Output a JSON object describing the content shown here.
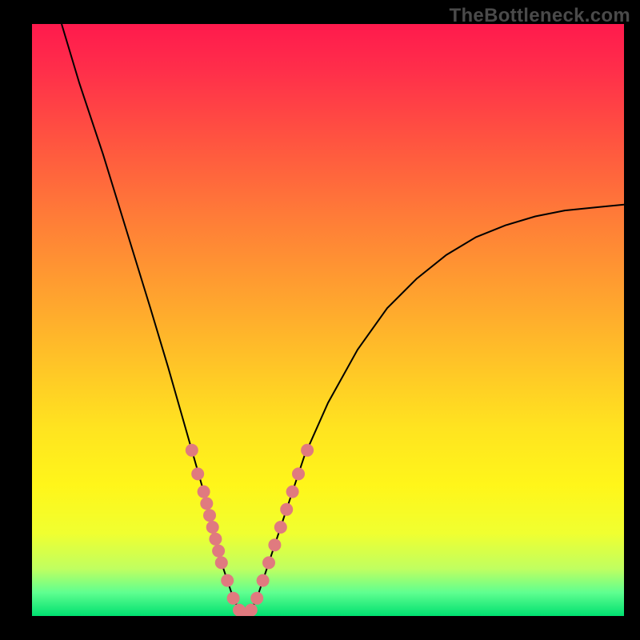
{
  "watermark": "TheBottleneck.com",
  "colors": {
    "frame": "#000000",
    "marker": "#e07a7f",
    "curve": "#000000",
    "gradient_top": "#ff1a4d",
    "gradient_bottom": "#00e070"
  },
  "chart_data": {
    "type": "line",
    "title": "",
    "xlabel": "",
    "ylabel": "",
    "xlim": [
      0,
      100
    ],
    "ylim": [
      0,
      100
    ],
    "grid": false,
    "legend": false,
    "series": [
      {
        "name": "bottleneck-curve",
        "x": [
          5,
          8,
          12,
          16,
          20,
          23,
          25,
          27,
          29,
          30,
          31,
          32,
          33,
          34,
          35,
          36,
          37,
          38,
          39,
          40,
          42,
          44,
          46,
          50,
          55,
          60,
          65,
          70,
          75,
          80,
          85,
          90,
          95,
          100
        ],
        "y": [
          100,
          90,
          78,
          65,
          52,
          42,
          35,
          28,
          21,
          17,
          13,
          9,
          6,
          3,
          1,
          0,
          1,
          3,
          6,
          9,
          15,
          21,
          27,
          36,
          45,
          52,
          57,
          61,
          64,
          66,
          67.5,
          68.5,
          69,
          69.5
        ]
      }
    ],
    "markers": {
      "name": "highlight-points",
      "points": [
        {
          "x": 27,
          "y": 28
        },
        {
          "x": 28,
          "y": 24
        },
        {
          "x": 29,
          "y": 21
        },
        {
          "x": 29.5,
          "y": 19
        },
        {
          "x": 30,
          "y": 17
        },
        {
          "x": 30.5,
          "y": 15
        },
        {
          "x": 31,
          "y": 13
        },
        {
          "x": 31.5,
          "y": 11
        },
        {
          "x": 32,
          "y": 9
        },
        {
          "x": 33,
          "y": 6
        },
        {
          "x": 34,
          "y": 3
        },
        {
          "x": 35,
          "y": 1
        },
        {
          "x": 36,
          "y": 0
        },
        {
          "x": 37,
          "y": 1
        },
        {
          "x": 38,
          "y": 3
        },
        {
          "x": 39,
          "y": 6
        },
        {
          "x": 40,
          "y": 9
        },
        {
          "x": 41,
          "y": 12
        },
        {
          "x": 42,
          "y": 15
        },
        {
          "x": 43,
          "y": 18
        },
        {
          "x": 44,
          "y": 21
        },
        {
          "x": 45,
          "y": 24
        },
        {
          "x": 46.5,
          "y": 28
        }
      ]
    }
  }
}
